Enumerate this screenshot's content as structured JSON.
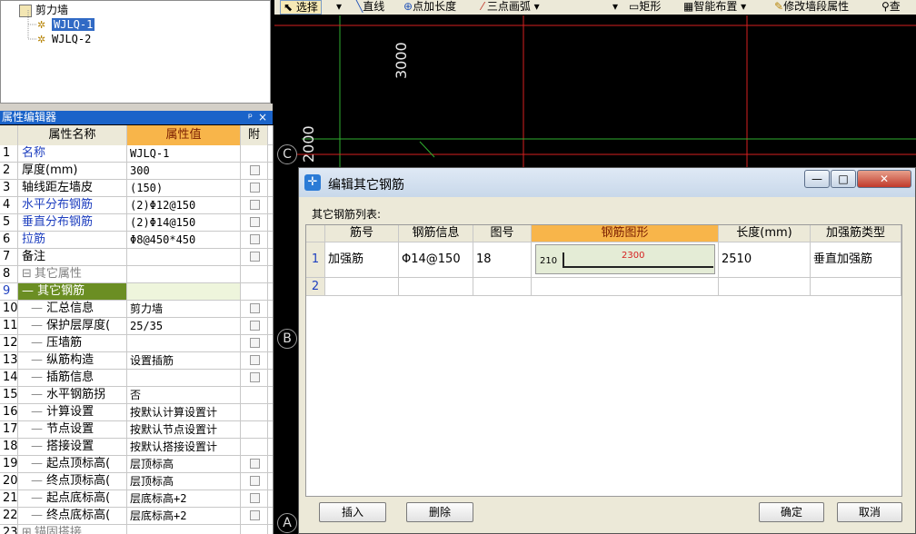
{
  "tree": {
    "root": "剪力墙",
    "items": [
      "WJLQ-1",
      "WJLQ-2"
    ]
  },
  "panel": {
    "title": "属性编辑器",
    "pin": "ᵖ",
    "close": "×"
  },
  "grid": {
    "headers": {
      "name": "属性名称",
      "value": "属性值",
      "attach": "附"
    },
    "rows": [
      {
        "n": "1",
        "name": "名称",
        "value": "WJLQ-1"
      },
      {
        "n": "2",
        "name": "厚度(mm)",
        "value": "300"
      },
      {
        "n": "3",
        "name": "轴线距左墙皮",
        "value": "(150)"
      },
      {
        "n": "4",
        "name": "水平分布钢筋",
        "value": "(2)Φ12@150"
      },
      {
        "n": "5",
        "name": "垂直分布钢筋",
        "value": "(2)Φ14@150"
      },
      {
        "n": "6",
        "name": "拉筋",
        "value": "Φ8@450*450"
      },
      {
        "n": "7",
        "name": "备注",
        "value": ""
      },
      {
        "n": "8",
        "name": "其它属性",
        "value": "",
        "expander": "⊟"
      },
      {
        "n": "9",
        "name": "其它钢筋",
        "value": ""
      },
      {
        "n": "10",
        "name": "汇总信息",
        "value": "剪力墙"
      },
      {
        "n": "11",
        "name": "保护层厚度(",
        "value": "25/35"
      },
      {
        "n": "12",
        "name": "压墙筋",
        "value": ""
      },
      {
        "n": "13",
        "name": "纵筋构造",
        "value": "设置插筋"
      },
      {
        "n": "14",
        "name": "插筋信息",
        "value": ""
      },
      {
        "n": "15",
        "name": "水平钢筋拐",
        "value": "否"
      },
      {
        "n": "16",
        "name": "计算设置",
        "value": "按默认计算设置计"
      },
      {
        "n": "17",
        "name": "节点设置",
        "value": "按默认节点设置计"
      },
      {
        "n": "18",
        "name": "搭接设置",
        "value": "按默认搭接设置计"
      },
      {
        "n": "19",
        "name": "起点顶标高(",
        "value": "层顶标高"
      },
      {
        "n": "20",
        "name": "终点顶标高(",
        "value": "层顶标高"
      },
      {
        "n": "21",
        "name": "起点底标高(",
        "value": "层底标高+2"
      },
      {
        "n": "22",
        "name": "终点底标高(",
        "value": "层底标高+2"
      },
      {
        "n": "23",
        "name": "锚固搭接",
        "value": "",
        "expander": "⊞"
      }
    ]
  },
  "toolbar": {
    "select": "选择",
    "line": "直线",
    "point_length": "点加长度",
    "arc": "三点画弧",
    "rect": "矩形",
    "smart": "智能布置",
    "modify": "修改墙段属性",
    "query": "查"
  },
  "cad": {
    "dim_top": "3000",
    "dim_left": "2000",
    "axis_c": "C",
    "axis_b": "B",
    "axis_a": "A"
  },
  "dialog": {
    "title": "编辑其它钢筋",
    "list_label": "其它钢筋列表:",
    "columns": [
      "筋号",
      "钢筋信息",
      "图号",
      "钢筋图形",
      "长度(mm)",
      "加强筋类型"
    ],
    "rows": [
      {
        "n": "1",
        "name": "加强筋",
        "info": "Φ14@150",
        "fig": "18",
        "shape_a": "210",
        "shape_b": "2300",
        "length": "2510",
        "type": "垂直加强筋"
      },
      {
        "n": "2",
        "name": "",
        "info": "",
        "fig": "",
        "shape_a": "",
        "shape_b": "",
        "length": "",
        "type": ""
      }
    ],
    "buttons": {
      "insert": "插入",
      "delete": "删除",
      "ok": "确定",
      "cancel": "取消"
    },
    "win": {
      "min": "—",
      "max": "□",
      "close": "✕"
    }
  }
}
